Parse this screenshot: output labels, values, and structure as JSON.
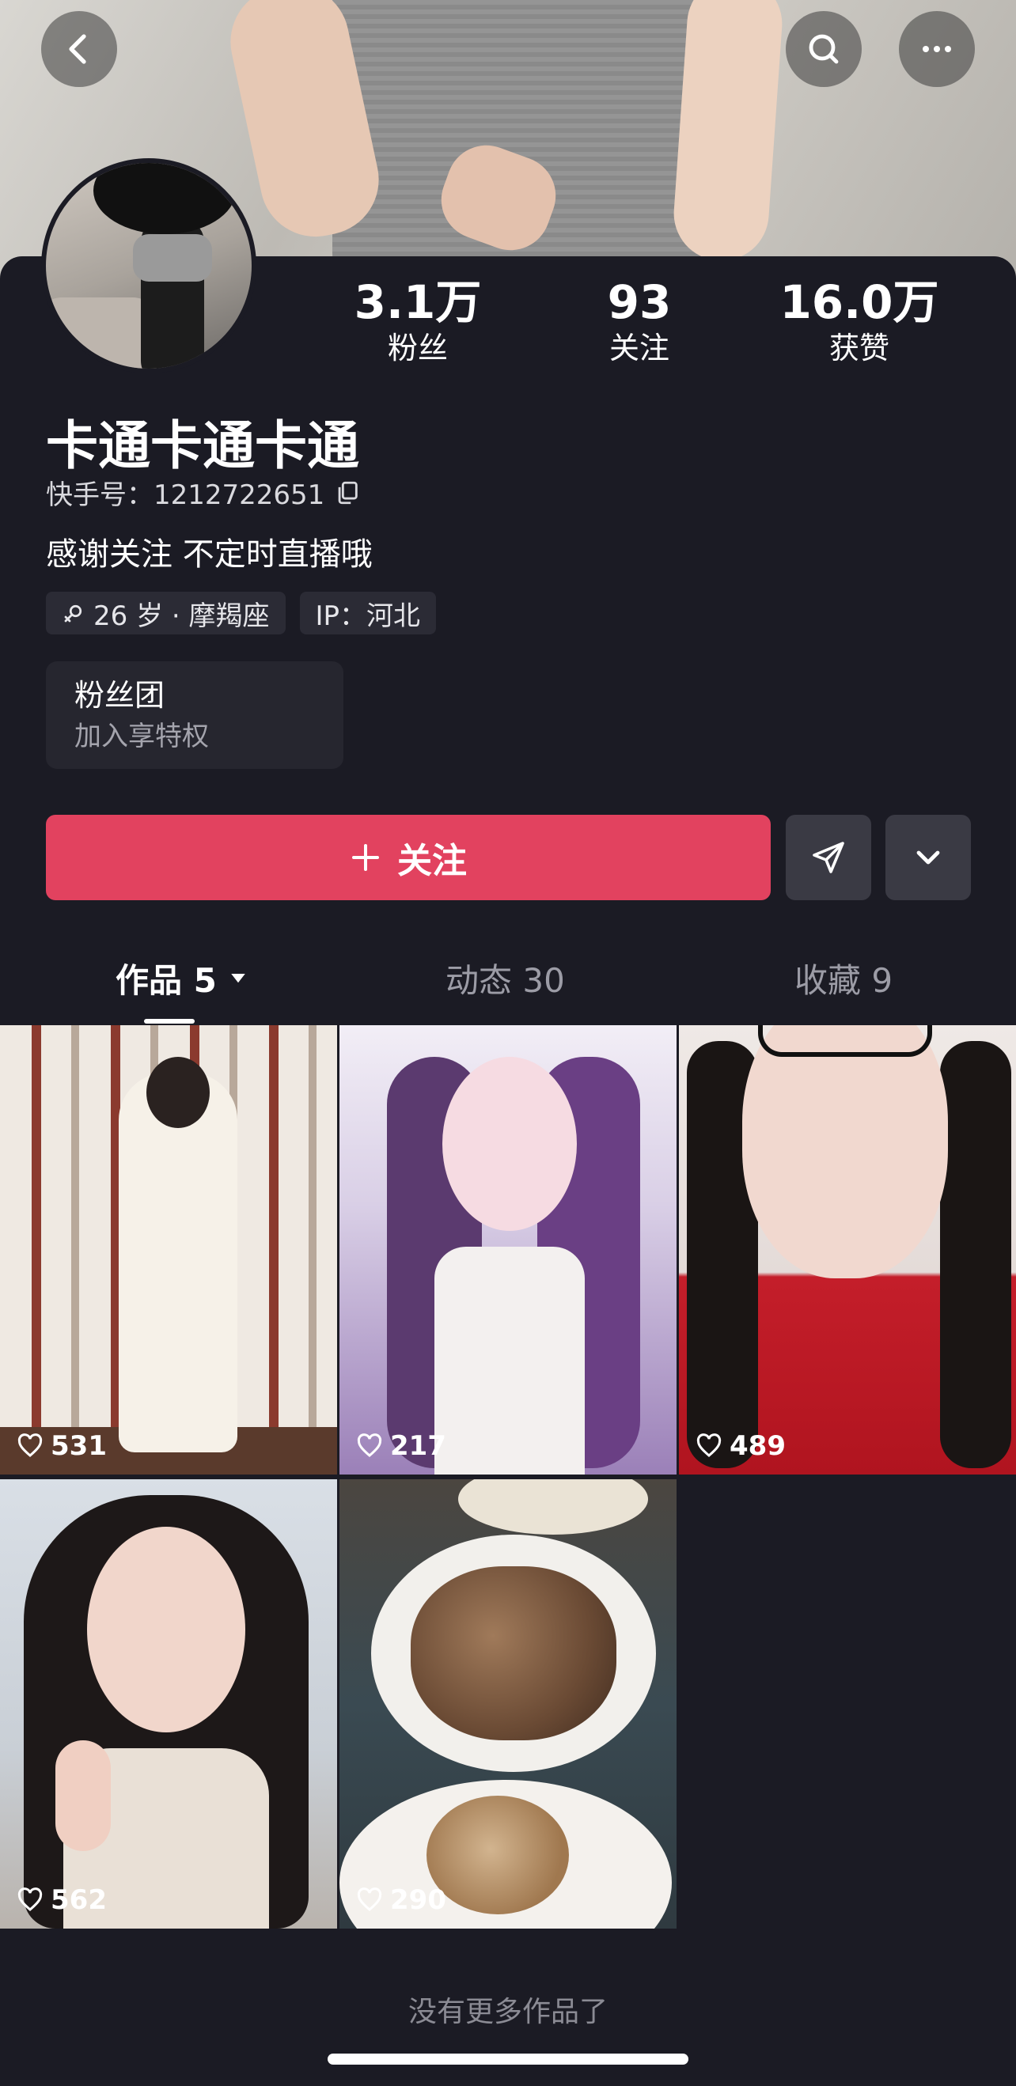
{
  "header": {
    "back_icon": "chevron-left-icon",
    "search_icon": "search-icon",
    "more_icon": "more-horizontal-icon"
  },
  "profile": {
    "stats": [
      {
        "value": "3.1万",
        "label": "粉丝"
      },
      {
        "value": "93",
        "label": "关注"
      },
      {
        "value": "16.0万",
        "label": "获赞"
      }
    ],
    "name": "卡通卡通卡通",
    "kuaishou_id": "快手号：1212722651",
    "bio": "感谢关注 不定时直播哦",
    "tags": [
      {
        "icon": "gender-female-icon",
        "text": "26 岁 · 摩羯座"
      },
      {
        "text": "IP：河北"
      }
    ],
    "fan_club": {
      "title": "粉丝团",
      "subtitle": "加入享特权"
    }
  },
  "actions": {
    "follow_label": "关注",
    "share_icon": "send-icon",
    "expand_icon": "chevron-down-icon"
  },
  "tabs": [
    {
      "label": "作品 5",
      "active": true
    },
    {
      "label": "动态 30",
      "active": false
    },
    {
      "label": "收藏 9",
      "active": false
    }
  ],
  "works": [
    {
      "likes": "531"
    },
    {
      "likes": "217"
    },
    {
      "likes": "489"
    },
    {
      "likes": "562"
    },
    {
      "likes": "290"
    }
  ],
  "footer": {
    "no_more": "没有更多作品了"
  },
  "colors": {
    "background": "#1b1b24",
    "accent": "#e2425f",
    "secondary_button": "#3a3a44"
  }
}
